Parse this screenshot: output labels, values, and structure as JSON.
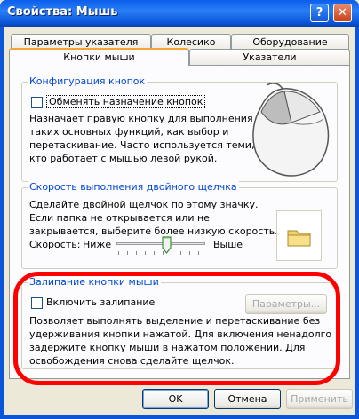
{
  "window": {
    "title": "Свойства: Мышь",
    "help_label": "?",
    "close_label": "✕"
  },
  "tabs": {
    "row_back": [
      "Параметры указателя",
      "Колесико",
      "Оборудование"
    ],
    "row_front": [
      "Кнопки мыши",
      "Указатели"
    ],
    "active": "Кнопки мыши"
  },
  "buttons_config": {
    "group_label": "Конфигурация кнопок",
    "checkbox_label": "Обменять назначение кнопок",
    "checked": false,
    "description": [
      "Назначает правую кнопку для выполнения",
      "таких основных функций, как выбор и",
      "перетаскивание. Часто используется теми,",
      "кто работает с мышью левой рукой."
    ]
  },
  "double_click": {
    "group_label": "Скорость выполнения двойного щелчка",
    "description": [
      "Сделайте двойной щелчок по этому значку.",
      "Если папка не открывается или не",
      "закрывается, выберите более низкую скорость."
    ],
    "speed_label": "Скорость:",
    "low_label": "Ниже",
    "high_label": "Выше",
    "slider_fraction": 0.55
  },
  "click_lock": {
    "group_label": "Залипание кнопки мыши",
    "checkbox_label": "Включить залипание",
    "checked": false,
    "settings_button": "Параметры...",
    "description": [
      "Позволяет выполнять выделение и перетаскивание без",
      "удерживания кнопки нажатой. Для включения ненадолго",
      "задержите кнопку мыши в нажатом положении. Для",
      "освобождения снова сделайте щелчок."
    ]
  },
  "footer": {
    "ok": "OK",
    "cancel": "Отмена",
    "apply": "Применить"
  },
  "colors": {
    "title_bar": "#0A5EEA",
    "group_label": "#0046D5",
    "highlight_oval": "#FF0000"
  }
}
